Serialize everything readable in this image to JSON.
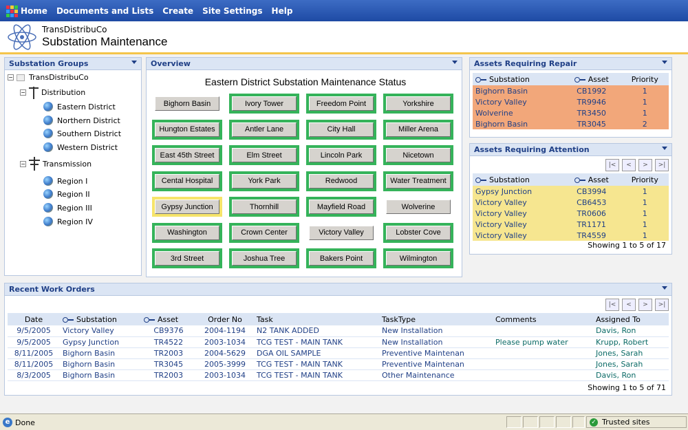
{
  "nav": {
    "items": [
      "Home",
      "Documents and Lists",
      "Create",
      "Site Settings",
      "Help"
    ]
  },
  "header": {
    "org": "TransDistribuCo",
    "title": "Substation Maintenance"
  },
  "groups": {
    "title": "Substation Groups",
    "root": "TransDistribuCo",
    "distribution": "Distribution",
    "districts": [
      "Eastern District",
      "Northern District",
      "Southern District",
      "Western District"
    ],
    "transmission": "Transmission",
    "regions": [
      "Region I",
      "Region II",
      "Region III",
      "Region IV"
    ]
  },
  "overview": {
    "title": "Overview",
    "chart_title": "Eastern District Substation Maintenance Status",
    "substations": [
      {
        "name": "Bighorn Basin",
        "status": "none"
      },
      {
        "name": "Ivory Tower",
        "status": "green"
      },
      {
        "name": "Freedom Point",
        "status": "green"
      },
      {
        "name": "Yorkshire",
        "status": "green"
      },
      {
        "name": "Hungton Estates",
        "status": "green"
      },
      {
        "name": "Antler Lane",
        "status": "green"
      },
      {
        "name": "City Hall",
        "status": "green"
      },
      {
        "name": "Miller Arena",
        "status": "green"
      },
      {
        "name": "East 45th Street",
        "status": "green"
      },
      {
        "name": "Elm Street",
        "status": "green"
      },
      {
        "name": "Lincoln Park",
        "status": "green"
      },
      {
        "name": "Nicetown",
        "status": "green"
      },
      {
        "name": "Cental Hospital",
        "status": "green"
      },
      {
        "name": "York Park",
        "status": "green"
      },
      {
        "name": "Redwood",
        "status": "green"
      },
      {
        "name": "Water Treatment",
        "status": "green"
      },
      {
        "name": "Gypsy Junction",
        "status": "yellow"
      },
      {
        "name": "Thornhill",
        "status": "green"
      },
      {
        "name": "Mayfield Road",
        "status": "green"
      },
      {
        "name": "Wolverine",
        "status": "none"
      },
      {
        "name": "Washington",
        "status": "green"
      },
      {
        "name": "Crown Center",
        "status": "green"
      },
      {
        "name": "Victory Valley",
        "status": "none"
      },
      {
        "name": "Lobster Cove",
        "status": "green"
      },
      {
        "name": "3rd Street",
        "status": "green"
      },
      {
        "name": "Joshua Tree",
        "status": "green"
      },
      {
        "name": "Bakers Point",
        "status": "green"
      },
      {
        "name": "Wilmington",
        "status": "green"
      }
    ]
  },
  "repair": {
    "title": "Assets Requiring Repair",
    "columns": [
      "Substation",
      "Asset",
      "Priority"
    ],
    "rows": [
      [
        "Bighorn Basin",
        "CB1992",
        "1"
      ],
      [
        "Victory Valley",
        "TR9946",
        "1"
      ],
      [
        "Wolverine",
        "TR3450",
        "1"
      ],
      [
        "Bighorn Basin",
        "TR3045",
        "2"
      ]
    ]
  },
  "attention": {
    "title": "Assets Requiring Attention",
    "columns": [
      "Substation",
      "Asset",
      "Priority"
    ],
    "rows": [
      [
        "Gypsy Junction",
        "CB3994",
        "1"
      ],
      [
        "Victory Valley",
        "CB6453",
        "1"
      ],
      [
        "Victory Valley",
        "TR0606",
        "1"
      ],
      [
        "Victory Valley",
        "TR1171",
        "1"
      ],
      [
        "Victory Valley",
        "TR4559",
        "1"
      ]
    ],
    "pager": [
      "|<",
      "<",
      ">",
      ">|"
    ],
    "showing": "Showing 1 to 5 of 17"
  },
  "workorders": {
    "title": "Recent Work Orders",
    "columns": [
      "Date",
      "Substation",
      "Asset",
      "Order No",
      "Task",
      "TaskType",
      "Comments",
      "Assigned To"
    ],
    "rows": [
      [
        "9/5/2005",
        "Victory Valley",
        "CB9376",
        "2004-1194",
        "N2 TANK ADDED",
        "New Installation",
        "",
        "Davis, Ron"
      ],
      [
        "9/5/2005",
        "Gypsy Junction",
        "TR4522",
        "2003-1034",
        "TCG TEST - MAIN TANK",
        "New Installation",
        "Please pump water",
        "Krupp, Robert"
      ],
      [
        "8/11/2005",
        "Bighorn Basin",
        "TR2003",
        "2004-5629",
        "DGA OIL SAMPLE",
        "Preventive Maintenan",
        "",
        "Jones, Sarah"
      ],
      [
        "8/11/2005",
        "Bighorn Basin",
        "TR3045",
        "2005-3999",
        "TCG TEST - MAIN TANK",
        "Preventive Maintenan",
        "",
        "Jones, Sarah"
      ],
      [
        "8/3/2005",
        "Bighorn Basin",
        "TR2003",
        "2003-1034",
        "TCG TEST - MAIN TANK",
        "Other Maintenance",
        "",
        "Davis, Ron"
      ]
    ],
    "pager": [
      "|<",
      "<",
      ">",
      ">|"
    ],
    "showing": "Showing 1 to 5 of 71"
  },
  "status": {
    "done": "Done",
    "zone": "Trusted sites"
  },
  "colors": {
    "repair": "#f2a77a",
    "attention": "#f6e690",
    "ok": "#35b35a",
    "warn": "#f6e46a"
  }
}
